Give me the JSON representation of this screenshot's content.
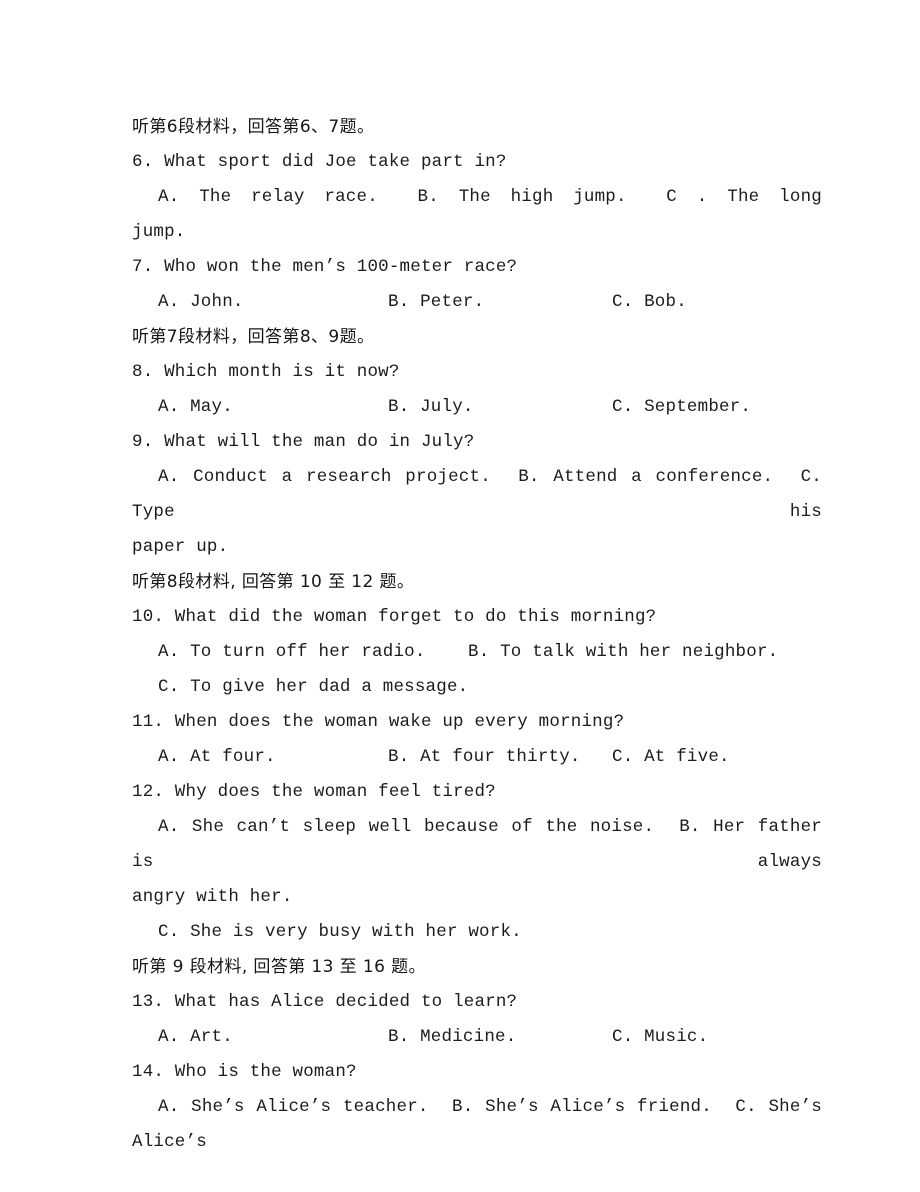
{
  "document": {
    "type": "english-listening-exam-paper",
    "blocks": [
      {
        "kind": "section-header",
        "name": "listening-passage-6-header",
        "text": "听第6段材料，回答第6、7题。"
      },
      {
        "kind": "question",
        "name": "question-6",
        "stem": "6. What sport did Joe take part in?",
        "option_line": "A. The relay race.  B. The high jump.  C . The long",
        "continuation": "jump.",
        "options": [
          "A. The relay race.",
          "B. The high jump.",
          "C . The long jump."
        ]
      },
      {
        "kind": "question",
        "name": "question-7",
        "stem": "7. Who won the men’s 100-meter race?",
        "options": [
          "A. John.",
          "B. Peter.",
          "C. Bob."
        ]
      },
      {
        "kind": "section-header",
        "name": "listening-passage-7-header",
        "text": "听第7段材料，回答第8、9题。"
      },
      {
        "kind": "question",
        "name": "question-8",
        "stem": "8. Which month is it now?",
        "options": [
          "A. May.",
          "B. July.",
          "C. September."
        ]
      },
      {
        "kind": "question",
        "name": "question-9",
        "stem": "9. What will the man do in July?",
        "option_line": "A. Conduct a research project.  B. Attend a conference.  C. Type his",
        "continuation": "paper up.",
        "options": [
          "A. Conduct a research project.",
          "B. Attend a conference.",
          "C. Type his paper up."
        ]
      },
      {
        "kind": "section-header",
        "name": "listening-passage-8-header",
        "text": "听第8段材料, 回答第 10 至 12 题。"
      },
      {
        "kind": "question",
        "name": "question-10",
        "stem": "10. What did the woman forget to do this morning?",
        "option_line": "A. To turn off her radio.  B. To talk with her neighbor.",
        "option_line2": "C. To give her dad a message.",
        "options": [
          "A. To turn off her radio.",
          "B. To talk with her neighbor.",
          "C. To give her dad a message."
        ]
      },
      {
        "kind": "question",
        "name": "question-11",
        "stem": "11. When does the woman wake up every morning?",
        "options": [
          "A. At four.",
          "B. At four thirty.",
          "C. At five."
        ]
      },
      {
        "kind": "question",
        "name": "question-12",
        "stem": "12. Why does the woman feel tired?",
        "option_line": "A. She can’t sleep well because of the noise.  B. Her father is always",
        "continuation": "angry with her.",
        "option_line2": "C. She is very busy with her work.",
        "options": [
          "A. She can’t sleep well because of the noise.",
          "B. Her father is always angry with her.",
          "C. She is very busy with her work."
        ]
      },
      {
        "kind": "section-header",
        "name": "listening-passage-9-header",
        "text": "听第 9 段材料, 回答第 13 至 16 题。"
      },
      {
        "kind": "question",
        "name": "question-13",
        "stem": "13. What has Alice decided to learn?",
        "options": [
          "A. Art.",
          "B. Medicine.",
          "C. Music."
        ]
      },
      {
        "kind": "question",
        "name": "question-14",
        "stem": "14. Who is the woman?",
        "option_line": "A. She’s Alice’s teacher.  B. She’s Alice’s friend.  C. She’s Alice’s",
        "options": [
          "A. She’s Alice’s teacher.",
          "B. She’s Alice’s friend.",
          "C. She’s Alice’s"
        ]
      }
    ]
  }
}
